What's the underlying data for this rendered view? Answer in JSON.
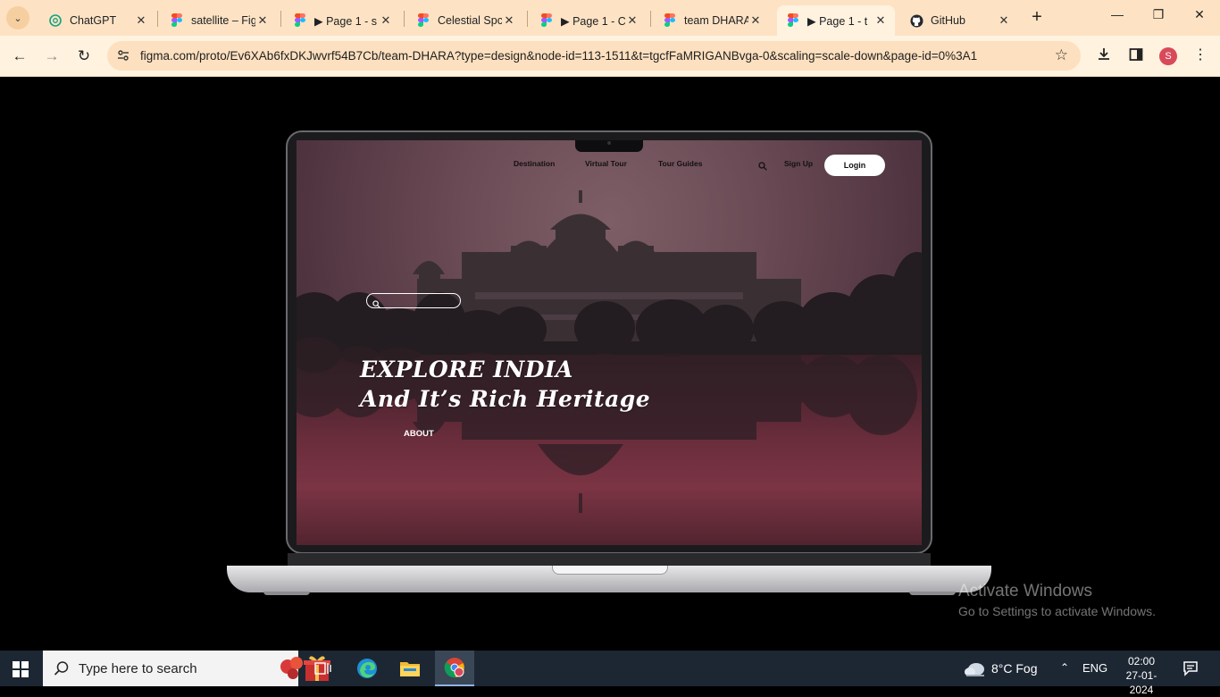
{
  "browser": {
    "tabs": [
      {
        "title": "ChatGPT",
        "icon": "chatgpt-icon",
        "active": false
      },
      {
        "title": "satellite – Fig",
        "icon": "figma-icon",
        "active": false
      },
      {
        "title": "▶ Page 1 - s",
        "icon": "figma-icon",
        "active": false
      },
      {
        "title": "Celestial Spc",
        "icon": "figma-icon",
        "active": false
      },
      {
        "title": "▶ Page 1 - C",
        "icon": "figma-icon",
        "active": false
      },
      {
        "title": "team DHARA",
        "icon": "figma-icon",
        "active": false
      },
      {
        "title": "▶ Page 1 - t",
        "icon": "figma-icon",
        "active": true
      },
      {
        "title": "GitHub",
        "icon": "github-icon",
        "active": false
      }
    ],
    "url": "figma.com/proto/Ev6XAb6fxDKJwvrf54B7Cb/team-DHARA?type=design&node-id=113-1511&t=tgcfFaMRIGANBvga-0&scaling=scale-down&page-id=0%3A1",
    "profile_initial": "S"
  },
  "site": {
    "nav": {
      "destination": "Destination",
      "virtual_tour": "Virtual Tour",
      "tour_guides": "Tour Guides",
      "sign_up": "Sign Up",
      "login": "Login"
    },
    "hero": {
      "title_line1": "EXPLORE INDIA",
      "title_line2": "And It’s Rich Heritage",
      "about": "ABOUT"
    }
  },
  "watermark": {
    "title": "Activate Windows",
    "subtitle": "Go to Settings to activate Windows."
  },
  "taskbar": {
    "search_placeholder": "Type here to search",
    "weather": "8°C  Fog",
    "language": "ENG",
    "time": "02:00",
    "date": "27-01-2024"
  },
  "colors": {
    "tabbar": "#fde3c4",
    "toolbar": "#fff2df",
    "taskbar": "#1d2733",
    "sky": "#6a4a54"
  }
}
